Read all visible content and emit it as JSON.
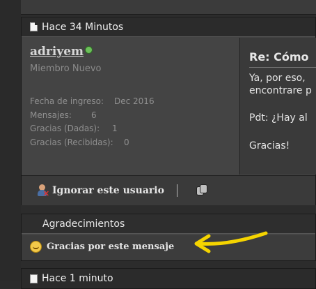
{
  "post": {
    "time": "Hace 34 Minutos",
    "user": {
      "name": "adriyem",
      "rank": "Miembro Nuevo",
      "join_label": "Fecha de ingreso:",
      "join_value": "Dec 2016",
      "posts_label": "Mensajes:",
      "posts_value": "6",
      "thanks_given_label": "Gracias (Dadas):",
      "thanks_given_value": "1",
      "thanks_received_label": "Gracias (Recibidas):",
      "thanks_received_value": "0"
    },
    "message": {
      "title": "Re: Cómo",
      "line1": "Ya, por eso,",
      "line2": "encontrare p",
      "line3": "Pdt: ¿Hay al",
      "line4": "Gracias!"
    },
    "footer": {
      "ignore_label": "Ignorar este usuario"
    }
  },
  "thanks_box": {
    "header": "Agradecimientos",
    "button_label": "Gracias por este mensaje"
  },
  "next_post": {
    "time": "Hace 1 minuto"
  },
  "colors": {
    "arrow": "#f5d400",
    "online": "#6cbf5a"
  }
}
